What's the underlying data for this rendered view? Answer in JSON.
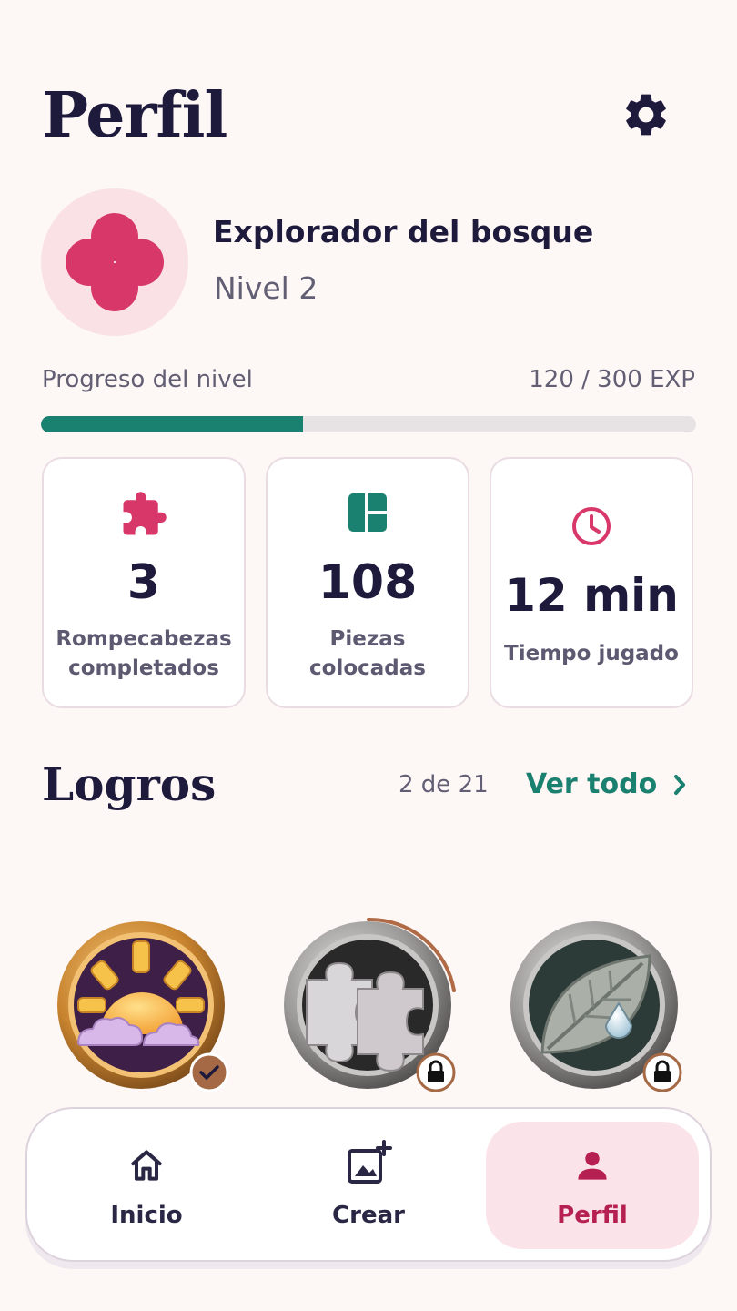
{
  "header": {
    "title": "Perfil",
    "settings_icon": "gear-icon"
  },
  "profile": {
    "name": "Explorador del bosque",
    "level": "Nivel 2",
    "avatar_icon": "flower-icon",
    "avatar_color": "#D8376A"
  },
  "progress": {
    "label": "Progreso del nivel",
    "value_text": "120 / 300 EXP",
    "current": 120,
    "max": 300,
    "color": "#1A8070"
  },
  "stats": [
    {
      "icon": "puzzle-piece-icon",
      "value": "3",
      "label": "Rompecabezas completados",
      "color": "#D8376A"
    },
    {
      "icon": "pieces-grid-icon",
      "value": "108",
      "label": "Piezas colocadas",
      "color": "#1A8070"
    },
    {
      "icon": "clock-icon",
      "value": "12 min",
      "label": "Tiempo jugado",
      "color": "#D8376A"
    }
  ],
  "achievements": {
    "title": "Logros",
    "count": "2 de 21",
    "see_all": "Ver todo",
    "badges": [
      {
        "name": "sunrise-badge",
        "state": "completed",
        "status_icon": "checkmark-icon"
      },
      {
        "name": "puzzle-badge",
        "state": "locked",
        "status_icon": "lock-icon"
      },
      {
        "name": "leaf-badge",
        "state": "locked",
        "status_icon": "lock-icon"
      }
    ]
  },
  "nav": {
    "items": [
      {
        "label": "Inicio",
        "icon": "home-icon",
        "active": false
      },
      {
        "label": "Crear",
        "icon": "add-image-icon",
        "active": false
      },
      {
        "label": "Perfil",
        "icon": "person-icon",
        "active": true
      }
    ]
  },
  "colors": {
    "background": "#FDF7F5",
    "accent_pink": "#D8376A",
    "accent_teal": "#1A8070",
    "nav_active_bg": "#FBE3EA",
    "text_dark": "#1E1A3C"
  }
}
